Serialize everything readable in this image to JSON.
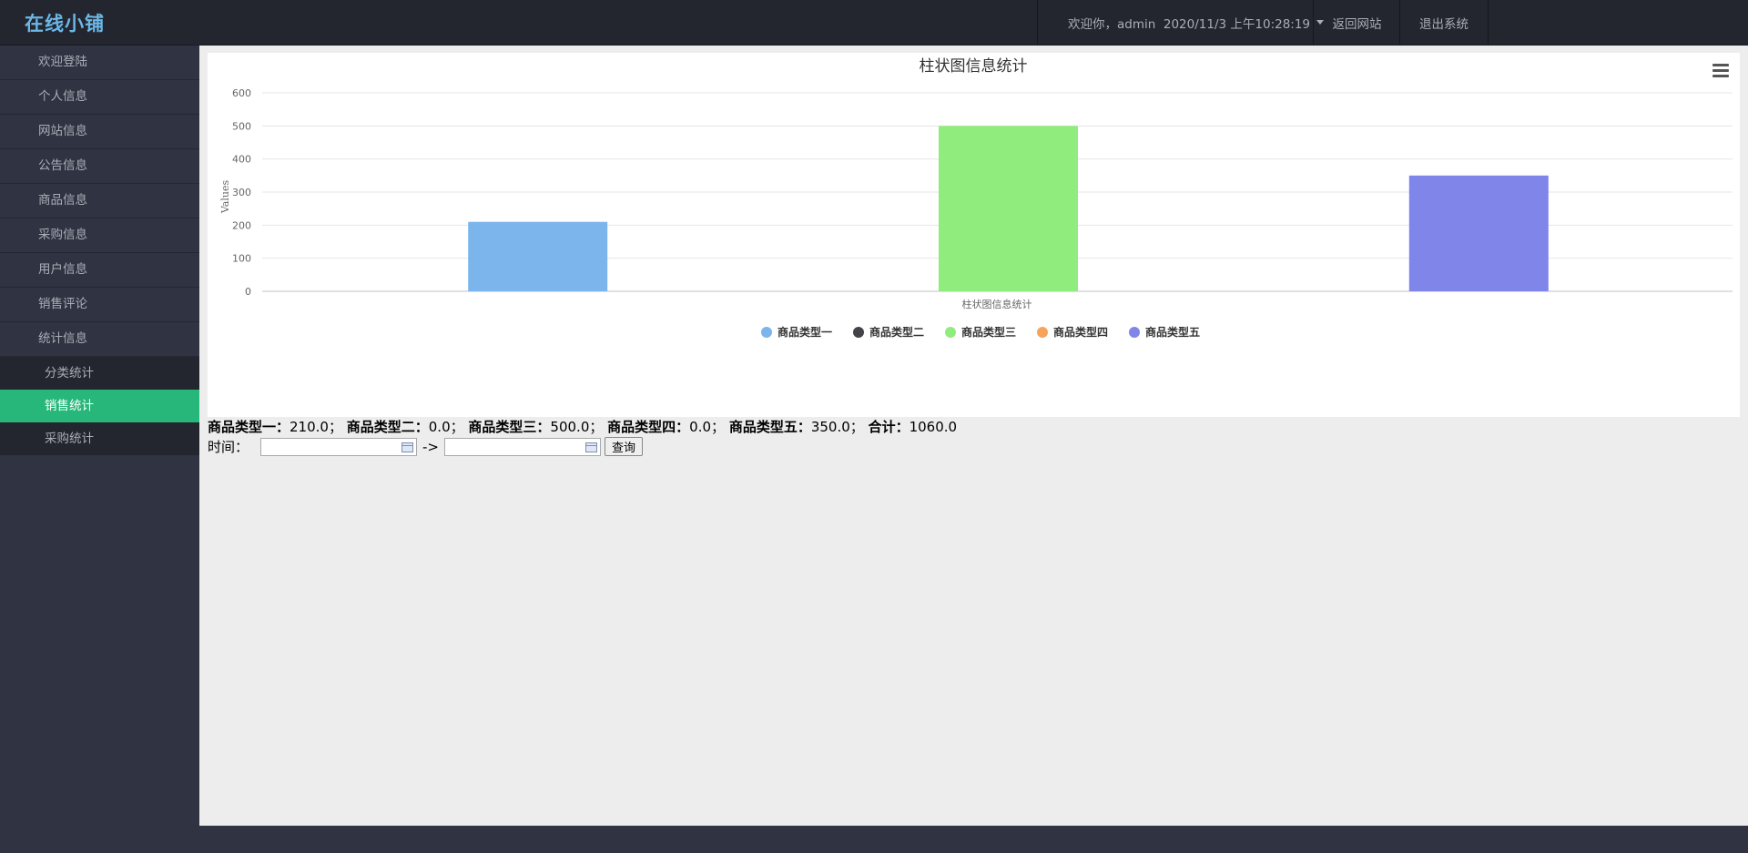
{
  "header": {
    "logo": "在线小铺",
    "welcome": "欢迎你，admin  2020/11/3 上午10:28:19",
    "back_site": "返回网站",
    "logout": "退出系统"
  },
  "sidebar": {
    "items": [
      "欢迎登陆",
      "个人信息",
      "网站信息",
      "公告信息",
      "商品信息",
      "采购信息",
      "用户信息",
      "销售评论",
      "统计信息"
    ],
    "subitems": [
      "分类统计",
      "销售统计",
      "采购统计"
    ],
    "active_subitem": "销售统计"
  },
  "chart_data": {
    "type": "bar",
    "title": "柱状图信息统计",
    "xlabel": "柱状图信息统计",
    "ylabel": "Values",
    "ylim": [
      0,
      600
    ],
    "yticks": [
      0,
      100,
      200,
      300,
      400,
      500,
      600
    ],
    "grid": true,
    "legend_position": "bottom-center",
    "series": [
      {
        "name": "商品类型一",
        "value": 210,
        "color": "#7cb5ec"
      },
      {
        "name": "商品类型二",
        "value": 0,
        "color": "#434348"
      },
      {
        "name": "商品类型三",
        "value": 500,
        "color": "#90ed7d"
      },
      {
        "name": "商品类型四",
        "value": 0,
        "color": "#f7a35c"
      },
      {
        "name": "商品类型五",
        "value": 350,
        "color": "#8085e9"
      }
    ]
  },
  "summary": {
    "items": [
      {
        "label": "商品类型一：",
        "value": "210.0；"
      },
      {
        "label": "商品类型二：",
        "value": "0.0；"
      },
      {
        "label": "商品类型三：",
        "value": "500.0；"
      },
      {
        "label": "商品类型四：",
        "value": "0.0；"
      },
      {
        "label": "商品类型五：",
        "value": "350.0；"
      },
      {
        "label": "合计：",
        "value": "1060.0"
      }
    ]
  },
  "query": {
    "time_label": "时间：",
    "arrow": "->",
    "start_value": "",
    "end_value": "",
    "button": "查询"
  }
}
